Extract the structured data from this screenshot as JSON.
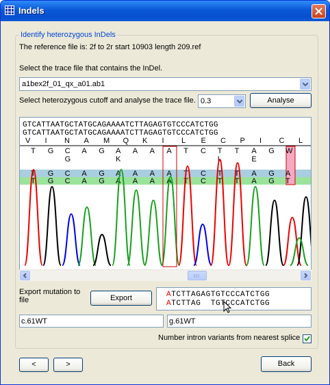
{
  "window": {
    "title": "Indels"
  },
  "group": {
    "legend": "Identify heterozygous InDels",
    "reference_text": "The reference file is: 2f to 2r start 10903 length 209.ref",
    "trace_prompt": "Select the trace file that contains the InDel.",
    "trace_file": "a1bex2f_01_qx_a01.ab1",
    "cutoff_prompt": "Select heterozygous cutoff and analyse the trace file.",
    "cutoff_value": "0.3",
    "analyse_label": "Analyse"
  },
  "trace": {
    "ref_row1": "GTCATTAATGCTATGCAGAAAATCTTAGAGTGTCCCATCTGG",
    "ref_row2": "GTCATTAATGCTATGCAGAAAATCTTAGAGTGTCCCATCTGG",
    "aa_row": [
      "V",
      "I",
      "N",
      "A",
      "M",
      "Q",
      "K",
      "I",
      "L",
      "E",
      "C",
      "P",
      "I",
      "C",
      "L"
    ],
    "calls": [
      {
        "top": "T",
        "mid": "",
        "blue": "T",
        "green": "T"
      },
      {
        "top": "G",
        "mid": "",
        "blue": "G",
        "green": "G"
      },
      {
        "top": "C",
        "mid": "G",
        "blue": "C",
        "green": "C"
      },
      {
        "top": "A",
        "mid": "",
        "blue": "A",
        "green": "A"
      },
      {
        "top": "G",
        "mid": "",
        "blue": "G",
        "green": "G"
      },
      {
        "top": "A",
        "mid": "K",
        "blue": "A",
        "green": "A"
      },
      {
        "top": "A",
        "mid": "",
        "blue": "A",
        "green": "A"
      },
      {
        "top": "A",
        "mid": "",
        "blue": "A",
        "green": "A"
      },
      {
        "top": "A",
        "mid": "",
        "blue": "A",
        "green": "A"
      },
      {
        "top": "T",
        "mid": "",
        "blue": "T",
        "green": "T"
      },
      {
        "top": "C",
        "mid": "",
        "blue": "C",
        "green": "C"
      },
      {
        "top": "T",
        "mid": "L",
        "blue": "T",
        "green": "T"
      },
      {
        "top": "T",
        "mid": "",
        "blue": "T",
        "green": "T"
      },
      {
        "top": "A",
        "mid": "E",
        "blue": "A",
        "green": "A"
      },
      {
        "top": "G",
        "mid": "",
        "blue": "G",
        "green": "G"
      },
      {
        "top": "W",
        "mid": "",
        "blue": "A",
        "green": "T"
      }
    ]
  },
  "export": {
    "label": "Export mutation to file",
    "button": "Export",
    "seq_line1": "ATCTTAGAGTGTCCCATCTGG",
    "seq_line2": "ATCTTAG  TGTCCCATCTGG",
    "c_notation": "c.61WT",
    "g_notation": "g.61WT",
    "number_intron_label": "Number intron variants from nearest splice",
    "number_intron_checked": true
  },
  "nav": {
    "prev": "<",
    "next": ">",
    "back": "Back"
  },
  "colors": {
    "A": "#17a11c",
    "C": "#0000ee",
    "G": "#000000",
    "T": "#ee0000",
    "accent_blue": "#0046d5",
    "highlight_box": "#cc0000"
  }
}
